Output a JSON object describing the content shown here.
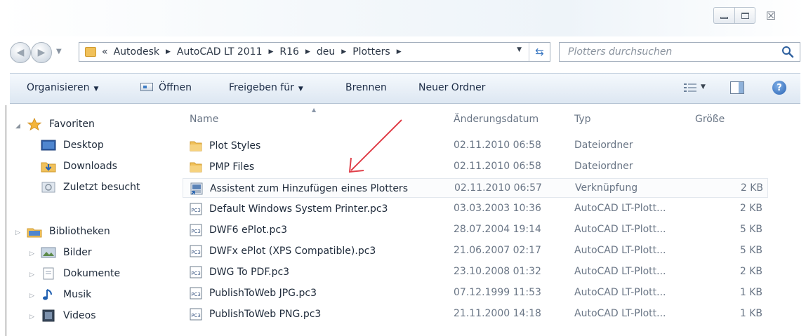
{
  "window": {
    "controls": {
      "minimize_icon": "minimize-icon",
      "maximize_icon": "maximize-icon",
      "close_glyph": "☒"
    }
  },
  "address_bar": {
    "overflow": "«",
    "crumbs": [
      "Autodesk",
      "AutoCAD LT 2011",
      "R16",
      "deu",
      "Plotters"
    ]
  },
  "search": {
    "placeholder": "Plotters durchsuchen"
  },
  "toolbar": {
    "organize": "Organisieren",
    "open": "Öffnen",
    "share": "Freigeben für",
    "burn": "Brennen",
    "new_folder": "Neuer Ordner"
  },
  "navigation": {
    "favorites": {
      "label": "Favoriten",
      "items": [
        "Desktop",
        "Downloads",
        "Zuletzt besucht"
      ]
    },
    "libraries": {
      "label": "Bibliotheken",
      "items": [
        "Bilder",
        "Dokumente",
        "Musik",
        "Videos"
      ]
    }
  },
  "columns": {
    "name": "Name",
    "date": "Änderungsdatum",
    "type": "Typ",
    "size": "Größe"
  },
  "files": [
    {
      "name": "Plot Styles",
      "date": "02.11.2010 06:58",
      "type": "Dateiordner",
      "size": "",
      "icon": "folder-icon"
    },
    {
      "name": "PMP Files",
      "date": "02.11.2010 06:58",
      "type": "Dateiordner",
      "size": "",
      "icon": "folder-icon"
    },
    {
      "name": "Assistent zum Hinzufügen eines Plotters",
      "date": "02.11.2010 06:57",
      "type": "Verknüpfung",
      "size": "2 KB",
      "icon": "shortcut-icon"
    },
    {
      "name": "Default Windows System Printer.pc3",
      "date": "03.03.2003 10:36",
      "type": "AutoCAD LT-Plott...",
      "size": "2 KB",
      "icon": "pc3-file-icon"
    },
    {
      "name": "DWF6 ePlot.pc3",
      "date": "28.07.2004 19:14",
      "type": "AutoCAD LT-Plott...",
      "size": "5 KB",
      "icon": "pc3-file-icon"
    },
    {
      "name": "DWFx ePlot (XPS Compatible).pc3",
      "date": "21.06.2007 02:17",
      "type": "AutoCAD LT-Plott...",
      "size": "5 KB",
      "icon": "pc3-file-icon"
    },
    {
      "name": "DWG To PDF.pc3",
      "date": "23.10.2008 01:32",
      "type": "AutoCAD LT-Plott...",
      "size": "2 KB",
      "icon": "pc3-file-icon"
    },
    {
      "name": "PublishToWeb JPG.pc3",
      "date": "07.12.1999 11:53",
      "type": "AutoCAD LT-Plott...",
      "size": "1 KB",
      "icon": "pc3-file-icon"
    },
    {
      "name": "PublishToWeb PNG.pc3",
      "date": "21.11.2000 14:18",
      "type": "AutoCAD LT-Plott...",
      "size": "1 KB",
      "icon": "pc3-file-icon"
    }
  ],
  "colors": {
    "annotation_arrow": "#e0404a",
    "folder": "#f1c15a",
    "accent": "#2a63b3"
  }
}
